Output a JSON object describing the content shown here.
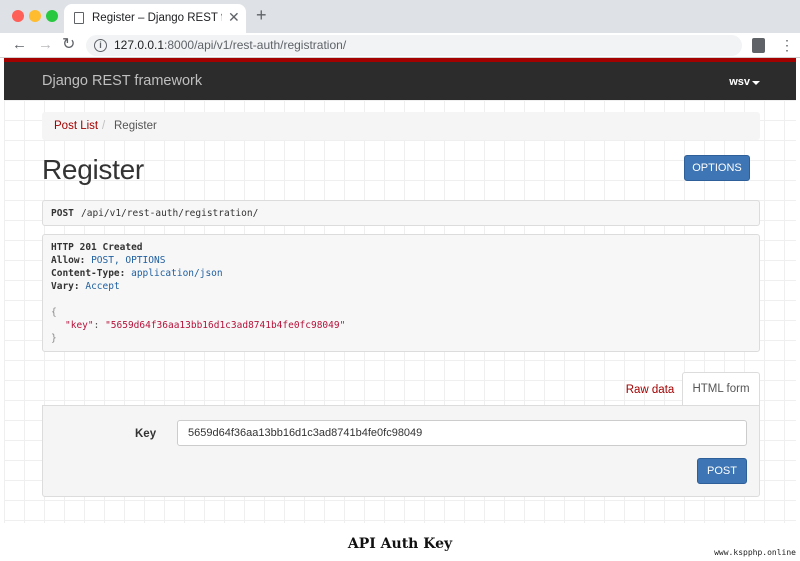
{
  "browser": {
    "tab_title": "Register – Django REST framew",
    "new_tab_label": "+",
    "url_host": "127.0.0.1",
    "url_path": ":8000/api/v1/rest-auth/registration/"
  },
  "navbar": {
    "brand": "Django REST framework",
    "user": "wsv",
    "accent_color": "#a30000",
    "background_color": "#2c2c2c"
  },
  "breadcrumb": {
    "link": "Post List",
    "separator": "/",
    "active": "Register"
  },
  "page": {
    "title": "Register",
    "options_label": "OPTIONS"
  },
  "request": {
    "method": "POST",
    "path": "/api/v1/rest-auth/registration/"
  },
  "response": {
    "status": "HTTP 201 Created",
    "allow_label": "Allow:",
    "allow_value": "POST, OPTIONS",
    "content_type_label": "Content-Type:",
    "content_type_value": "application/json",
    "vary_label": "Vary:",
    "vary_value": "Accept",
    "open_brace": "{",
    "json_key": "\"key\"",
    "json_colon": ":",
    "json_value": "\"5659d64f36aa13bb16d1c3ad8741b4fe0fc98049\"",
    "close_brace": "}"
  },
  "tabs": {
    "raw": "Raw data",
    "html": "HTML form"
  },
  "form": {
    "key_label": "Key",
    "key_value": "5659d64f36aa13bb16d1c3ad8741b4fe0fc98049",
    "post_label": "POST"
  },
  "caption": "API Auth Key",
  "watermark": "www.kspphp.online",
  "colors": {
    "button_blue": "#3d75b5",
    "link_red": "#a30000",
    "json_red": "#b5123a",
    "header_blue": "#1f5fa0"
  }
}
